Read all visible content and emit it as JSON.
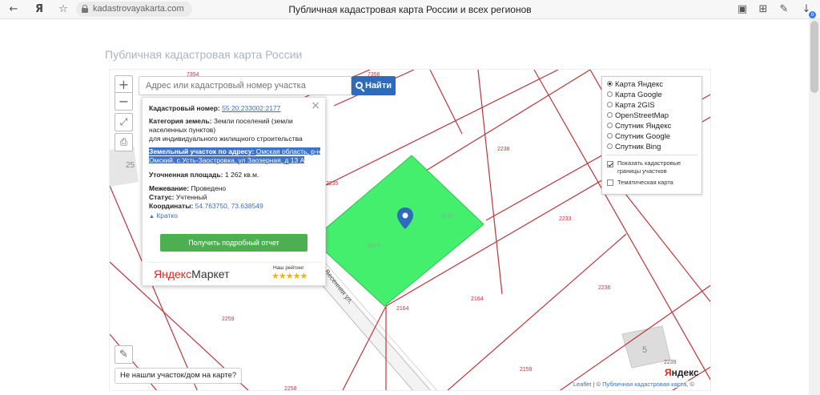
{
  "browser": {
    "url": "kadastrovayakarta.com",
    "tab_title": "Публичная кадастровая карта России и всех регионов",
    "notifications_count": "0"
  },
  "page": {
    "heading": "Публичная кадастровая карта России"
  },
  "search": {
    "placeholder": "Адрес или кадастровый номер участка",
    "button_label": "Найти"
  },
  "popup": {
    "cadastral_label": "Кадастровый номер:",
    "cadastral_value": "55:20:233002:2177",
    "category_label": "Категория земель:",
    "category_value_1": "Земли поселений (земли",
    "category_value_2": "населенных пунктов)",
    "category_value_3": "для индивидуального жилищного строительства",
    "address_label": "Земельный участок по адресу:",
    "address_line_1": "Омская область, р-н",
    "address_line_2": "Омский, с.Усть-Заостровка, ул Заозерная, д 13 А",
    "area_label": "Уточненная площадь:",
    "area_value": "1 262 кв.м.",
    "survey_label": "Межевание:",
    "survey_value": "Проведено",
    "status_label": "Статус:",
    "status_value": "Учтенный",
    "coords_label": "Координаты:",
    "coords_value": "54.763750, 73.638549",
    "collapse_link": "Кратко",
    "detail_button": "Получить подробный отчет",
    "ad_logo_ya": "Яндекс",
    "ad_logo_market": "Маркет",
    "rating_label": "Наш рейтинг",
    "stars": "★★★★★"
  },
  "layers": {
    "options": [
      "Карта Яндекс",
      "Карта Google",
      "Карта 2GIS",
      "OpenStreetMap",
      "Спутник Яндекс",
      "Спутник Google",
      "Спутник Bing"
    ],
    "selected": "Карта Яндекс",
    "show_borders_1": "Показать кадастровые",
    "show_borders_2": "границы участков",
    "thematic": "Тематическая карта"
  },
  "map": {
    "parcel_labels": {
      "p7354": "7354",
      "p7356": "7356",
      "p2235": "2235",
      "p2238": "2238",
      "p2233": "2233",
      "p2236": "2236",
      "p2164a": "2164",
      "p2164b": "2164",
      "p2259": "2259",
      "p2159": "2159",
      "p2239": "2239",
      "p2258": "2258",
      "p2177a": "2177",
      "p2177b": "2177",
      "house_5": "5",
      "house_25": "25"
    },
    "street_label": "Весенняя ул.",
    "not_found": "Не нашли участок/дом на карте?",
    "attr_leaflet": "Leaflet",
    "attr_sep": " | © ",
    "attr_pkk": "Публичная кадастровая карта",
    "attr_tail": ", ©",
    "yandex_logo_y": "Я",
    "yandex_logo_rest": "ндекс",
    "highlight_color": "#45ef6e",
    "boundary_color": "#c0343a"
  }
}
